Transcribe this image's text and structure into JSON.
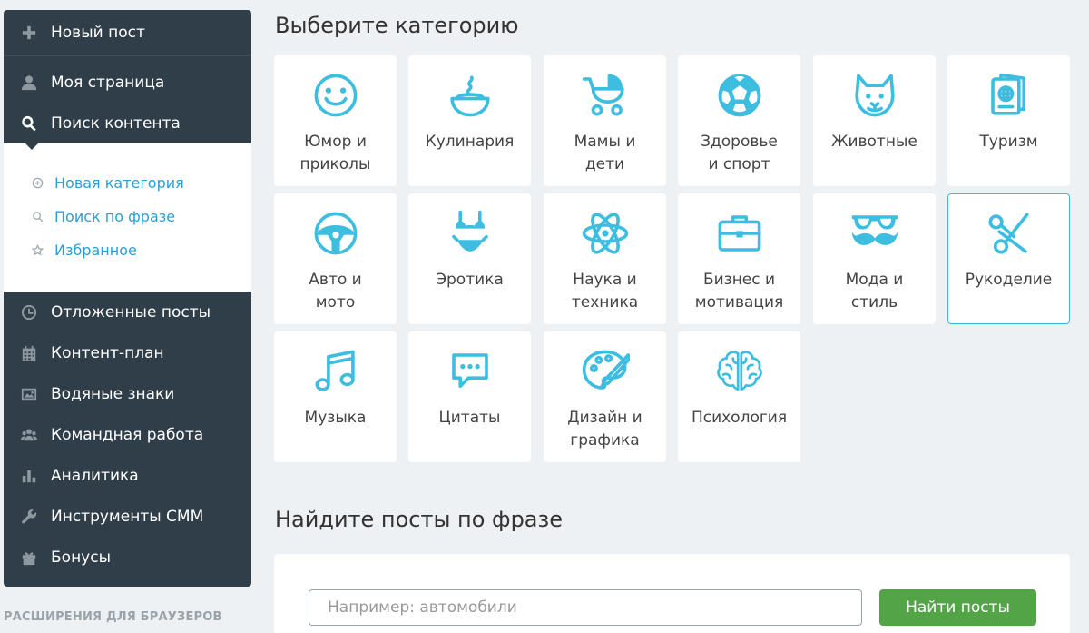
{
  "sidebar": {
    "new_post": "Новый пост",
    "my_page": "Моя страница",
    "search_content": "Поиск контента",
    "submenu": {
      "new_category": "Новая категория",
      "phrase_search": "Поиск по фразе",
      "favorites": "Избранное"
    },
    "scheduled_posts": "Отложенные посты",
    "content_plan": "Контент-план",
    "watermarks": "Водяные знаки",
    "team_work": "Командная работа",
    "analytics": "Аналитика",
    "smm_tools": "Инструменты СММ",
    "bonuses": "Бонусы"
  },
  "extensions_label": "РАСШИРЕНИЯ ДЛЯ БРАУЗЕРОВ",
  "categories_title": "Выберите категорию",
  "categories": [
    {
      "label": "Юмор и\nприколы",
      "icon": "smile-icon"
    },
    {
      "label": "Кулинария",
      "icon": "bowl-icon"
    },
    {
      "label": "Мамы и\nдети",
      "icon": "stroller-icon"
    },
    {
      "label": "Здоровье\nи спорт",
      "icon": "soccer-ball-icon"
    },
    {
      "label": "Животные",
      "icon": "cat-icon"
    },
    {
      "label": "Туризм",
      "icon": "passport-icon"
    },
    {
      "label": "Авто и\nмото",
      "icon": "steering-wheel-icon"
    },
    {
      "label": "Эротика",
      "icon": "bikini-icon"
    },
    {
      "label": "Наука и\nтехника",
      "icon": "atom-icon"
    },
    {
      "label": "Бизнес и\nмотивация",
      "icon": "briefcase-icon"
    },
    {
      "label": "Мода и\nстиль",
      "icon": "glasses-mustache-icon"
    },
    {
      "label": "Рукоделие",
      "icon": "scissors-icon"
    },
    {
      "label": "Музыка",
      "icon": "music-note-icon"
    },
    {
      "label": "Цитаты",
      "icon": "chat-bubble-icon"
    },
    {
      "label": "Дизайн и\nграфика",
      "icon": "palette-icon"
    },
    {
      "label": "Психология",
      "icon": "brain-icon"
    }
  ],
  "selected_category": "Рукоделие",
  "phrase_title": "Найдите посты по фразе",
  "search": {
    "placeholder": "Например: автомобили",
    "value": "",
    "button": "Найти посты"
  },
  "colors": {
    "sidebar_bg": "#2f3e48",
    "accent": "#3dbde0",
    "link": "#2a9fd6",
    "button": "#52a447"
  }
}
